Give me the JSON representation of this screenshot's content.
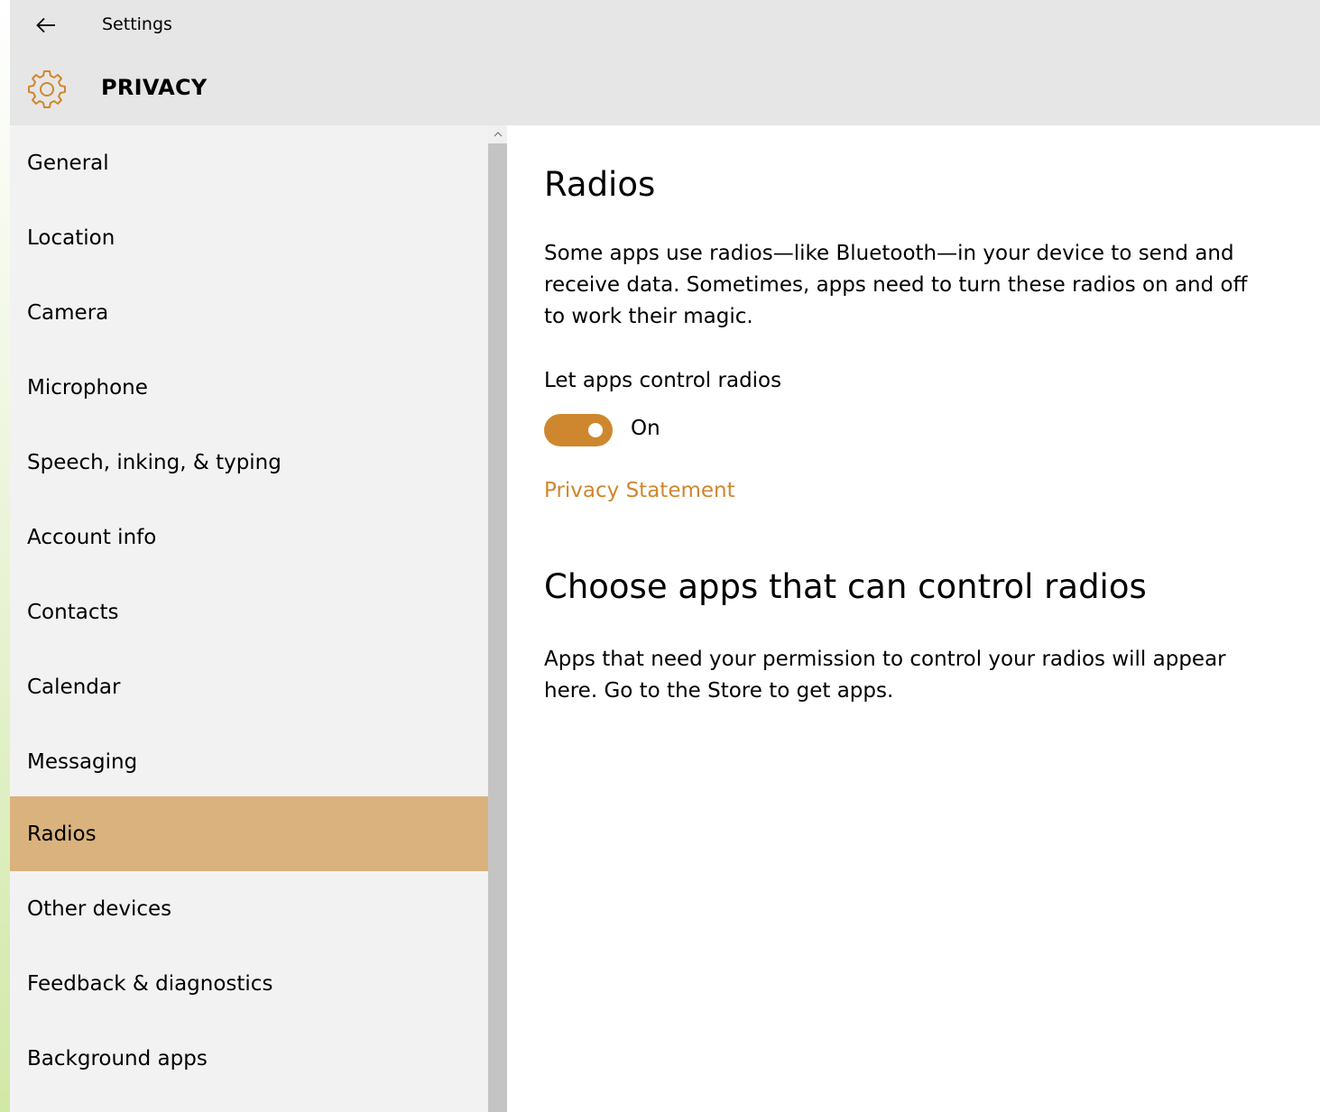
{
  "window": {
    "app_title": "Settings",
    "section_title": "PRIVACY",
    "accent_color": "#cf872f",
    "selected_bg": "#dab27d"
  },
  "icons": {
    "back": "back-arrow-icon",
    "section": "gear-icon",
    "scroll_up": "chevron-up-icon"
  },
  "sidebar": {
    "items": [
      {
        "label": "General",
        "selected": false
      },
      {
        "label": "Location",
        "selected": false
      },
      {
        "label": "Camera",
        "selected": false
      },
      {
        "label": "Microphone",
        "selected": false
      },
      {
        "label": "Speech, inking, & typing",
        "selected": false
      },
      {
        "label": "Account info",
        "selected": false
      },
      {
        "label": "Contacts",
        "selected": false
      },
      {
        "label": "Calendar",
        "selected": false
      },
      {
        "label": "Messaging",
        "selected": false
      },
      {
        "label": "Radios",
        "selected": true
      },
      {
        "label": "Other devices",
        "selected": false
      },
      {
        "label": "Feedback & diagnostics",
        "selected": false
      },
      {
        "label": "Background apps",
        "selected": false
      }
    ]
  },
  "main": {
    "title": "Radios",
    "description": "Some apps use radios—like Bluetooth—in your device to send and receive data. Sometimes, apps need to turn these radios on and off to work their magic.",
    "toggle_label": "Let apps control radios",
    "toggle_state": "On",
    "toggle_on": true,
    "privacy_link": "Privacy Statement",
    "section2_title": "Choose apps that can control radios",
    "section2_description": "Apps that need your permission to control your radios will appear here. Go to the Store to get apps."
  }
}
